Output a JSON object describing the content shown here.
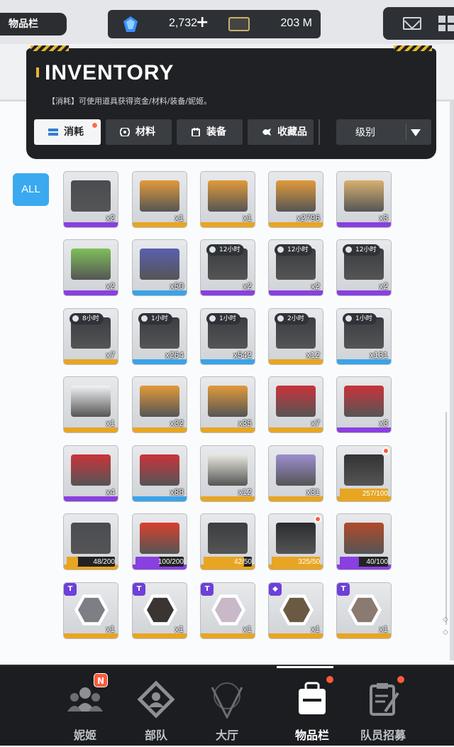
{
  "topbar": {
    "screen_title": "物品栏",
    "gems": "2,732",
    "gems_plus": "+",
    "credits": "203 M"
  },
  "inventory": {
    "title": "INVENTORY",
    "description": "【消耗】可使用道具获得资金/材料/装备/妮姬。",
    "tabs": [
      {
        "label": "消耗",
        "active": true,
        "notify": true
      },
      {
        "label": "材料",
        "active": false,
        "notify": false
      },
      {
        "label": "装备",
        "active": false,
        "notify": false
      },
      {
        "label": "收藏品",
        "active": false,
        "notify": false
      }
    ],
    "sort_label": "级别",
    "all_label": "ALL"
  },
  "rarity_colors": {
    "purple": "#8a3fe0",
    "gold": "#e8a522",
    "blue": "#3aa3e8"
  },
  "items": [
    {
      "row": 0,
      "col": 0,
      "count": "x2",
      "rarity": "purple",
      "art": "#4a4c50"
    },
    {
      "row": 0,
      "col": 1,
      "count": "x1",
      "rarity": "gold",
      "art": "#e19a3a"
    },
    {
      "row": 0,
      "col": 2,
      "count": "x1",
      "rarity": "gold",
      "art": "#e19a3a"
    },
    {
      "row": 0,
      "col": 3,
      "count": "x2796",
      "rarity": "gold",
      "art": "#e19a3a"
    },
    {
      "row": 0,
      "col": 4,
      "count": "x3",
      "rarity": "purple",
      "art": "#d8b070"
    },
    {
      "row": 1,
      "col": 0,
      "count": "x2",
      "rarity": "purple",
      "art": "#7fbf5a"
    },
    {
      "row": 1,
      "col": 1,
      "count": "x50",
      "rarity": "blue",
      "art": "#5a5fae"
    },
    {
      "row": 1,
      "col": 2,
      "count": "x2",
      "rarity": "purple",
      "art": "#3b3d42",
      "timer": "12小时"
    },
    {
      "row": 1,
      "col": 3,
      "count": "x2",
      "rarity": "purple",
      "art": "#3b3d42",
      "timer": "12小时"
    },
    {
      "row": 1,
      "col": 4,
      "count": "x2",
      "rarity": "purple",
      "art": "#3b3d42",
      "timer": "12小时"
    },
    {
      "row": 2,
      "col": 0,
      "count": "x7",
      "rarity": "gold",
      "art": "#3b3d42",
      "timer": "8小时"
    },
    {
      "row": 2,
      "col": 1,
      "count": "x264",
      "rarity": "blue",
      "art": "#3b3d42",
      "timer": "1小时"
    },
    {
      "row": 2,
      "col": 2,
      "count": "x542",
      "rarity": "blue",
      "art": "#3b3d42",
      "timer": "1小时"
    },
    {
      "row": 2,
      "col": 3,
      "count": "x12",
      "rarity": "gold",
      "art": "#3b3d42",
      "timer": "2小时"
    },
    {
      "row": 2,
      "col": 4,
      "count": "x131",
      "rarity": "blue",
      "art": "#3b3d42",
      "timer": "1小时"
    },
    {
      "row": 3,
      "col": 0,
      "count": "x1",
      "rarity": "gold",
      "art": "#f2f3f5"
    },
    {
      "row": 3,
      "col": 1,
      "count": "x32",
      "rarity": "gold",
      "art": "#e19a3a"
    },
    {
      "row": 3,
      "col": 2,
      "count": "x35",
      "rarity": "gold",
      "art": "#e19a3a"
    },
    {
      "row": 3,
      "col": 3,
      "count": "x7",
      "rarity": "gold",
      "art": "#c9333a"
    },
    {
      "row": 3,
      "col": 4,
      "count": "x3",
      "rarity": "purple",
      "art": "#c9333a"
    },
    {
      "row": 4,
      "col": 0,
      "count": "x4",
      "rarity": "purple",
      "art": "#c9333a"
    },
    {
      "row": 4,
      "col": 1,
      "count": "x88",
      "rarity": "blue",
      "art": "#c9333a"
    },
    {
      "row": 4,
      "col": 2,
      "count": "x12",
      "rarity": "gold",
      "art": "#e8e8e0"
    },
    {
      "row": 4,
      "col": 3,
      "count": "x31",
      "rarity": "gold",
      "art": "#9c8ed0"
    },
    {
      "row": 4,
      "col": 4,
      "rarity": "gold",
      "art": "#333",
      "progress": "257/100",
      "fill": 1.0,
      "dot": true
    },
    {
      "row": 5,
      "col": 0,
      "rarity": "gold",
      "art": "#4a4c52",
      "progress": "48/200",
      "fill": 0.24
    },
    {
      "row": 5,
      "col": 1,
      "rarity": "purple",
      "art": "#d8402e",
      "progress": "100/200",
      "fill": 0.5
    },
    {
      "row": 5,
      "col": 2,
      "rarity": "gold",
      "art": "#3b3d42",
      "progress": "42/50",
      "fill": 0.84
    },
    {
      "row": 5,
      "col": 3,
      "rarity": "gold",
      "art": "#2a2c30",
      "progress": "325/50",
      "fill": 1.0,
      "dot": true
    },
    {
      "row": 5,
      "col": 4,
      "rarity": "purple",
      "art": "#b24a2a",
      "progress": "40/100",
      "fill": 0.4
    },
    {
      "row": 6,
      "col": 0,
      "count": "x1",
      "rarity": "gold",
      "art": "#7d7f84",
      "hex": true,
      "badge": "T"
    },
    {
      "row": 6,
      "col": 1,
      "count": "x1",
      "rarity": "gold",
      "art": "#3a3530",
      "hex": true,
      "badge": "T"
    },
    {
      "row": 6,
      "col": 2,
      "count": "x1",
      "rarity": "gold",
      "art": "#c9b8c8",
      "hex": true,
      "badge": "T"
    },
    {
      "row": 6,
      "col": 3,
      "count": "x1",
      "rarity": "gold",
      "art": "#6a5a44",
      "hex": true,
      "badge": "◆"
    },
    {
      "row": 6,
      "col": 4,
      "count": "x1",
      "rarity": "gold",
      "art": "#8a7a70",
      "hex": true,
      "badge": "T"
    }
  ],
  "nav": [
    {
      "label": "妮姬",
      "badge": "N",
      "active": false
    },
    {
      "label": "部队",
      "active": false
    },
    {
      "label": "大厅",
      "active": false
    },
    {
      "label": "物品栏",
      "active": true,
      "dot": true
    },
    {
      "label": "队员招募",
      "active": false,
      "dot": true
    }
  ]
}
